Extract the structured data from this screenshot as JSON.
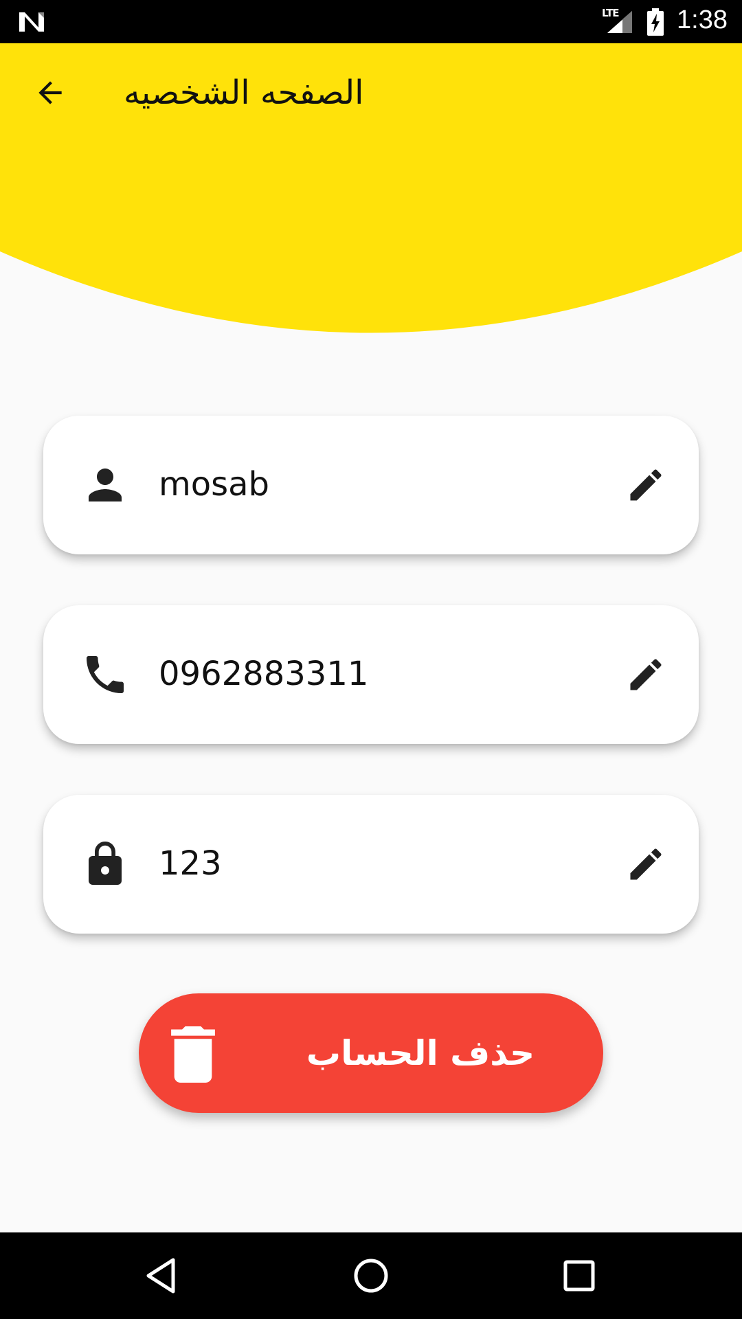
{
  "status_bar": {
    "network_label": "LTE",
    "time": "1:38"
  },
  "header": {
    "title": "الصفحه الشخصيه",
    "background_color": "#ffe20a"
  },
  "profile": {
    "name": {
      "value": "mosab",
      "icon": "person-icon",
      "action_icon": "pencil-icon"
    },
    "phone": {
      "value": "0962883311",
      "icon": "phone-icon",
      "action_icon": "pencil-icon"
    },
    "password": {
      "value": "123",
      "icon": "lock-icon",
      "action_icon": "pencil-icon"
    }
  },
  "delete_account": {
    "label": "حذف الحساب",
    "icon": "trash-icon",
    "color": "#f44336"
  },
  "nav_bar": {
    "buttons": [
      "back-triangle-icon",
      "home-circle-icon",
      "recents-square-icon"
    ]
  }
}
